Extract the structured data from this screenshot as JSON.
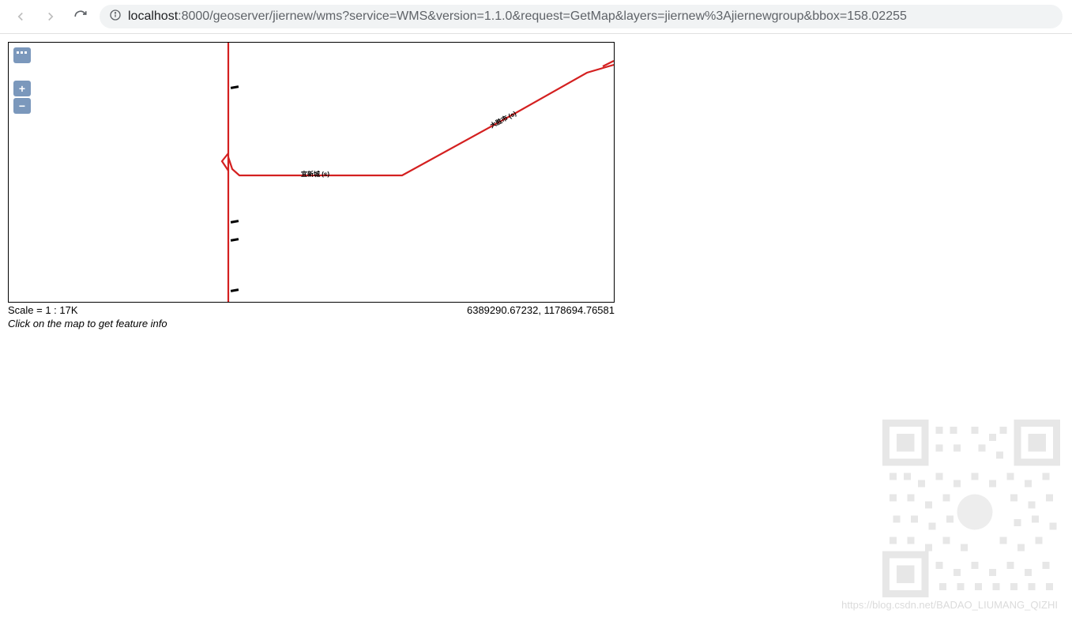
{
  "browser": {
    "url_host": "localhost",
    "url_rest": ":8000/geoserver/jiernew/wms?service=WMS&version=1.1.0&request=GetMap&layers=jiernew%3Ajiernewgroup&bbox=158.02255"
  },
  "map": {
    "controls": {
      "layers_glyph": "⋯",
      "zoom_in": "+",
      "zoom_out": "−"
    },
    "scale_text": "Scale = 1 : 17K",
    "coords_text": "6389290.67232, 1178694.76581",
    "hint_text": "Click on the map to get feature info",
    "labels": {
      "road1": "宜新城 (s)",
      "road2": "大胜市 (s)"
    }
  },
  "watermark": {
    "text": "https://blog.csdn.net/BADAO_LIUMANG_QIZHI"
  }
}
